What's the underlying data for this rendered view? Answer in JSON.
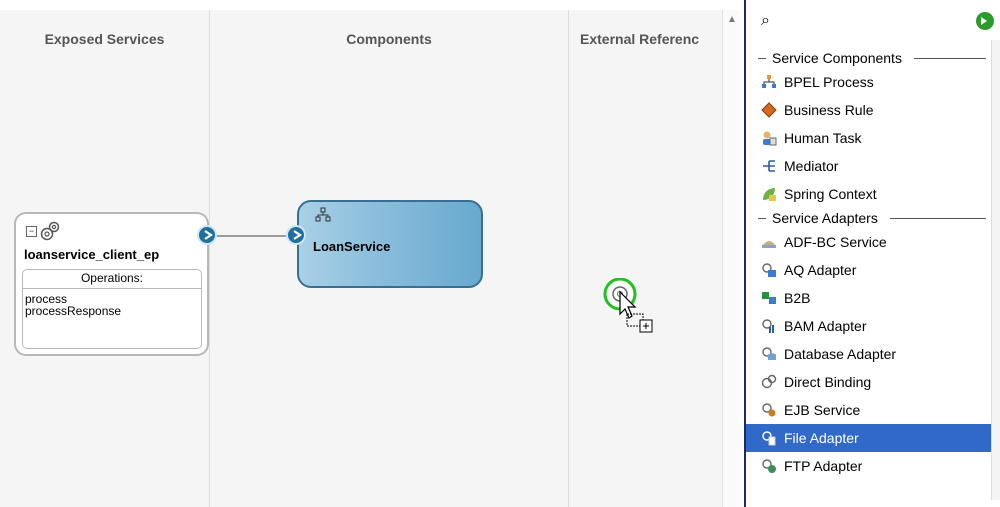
{
  "lanes": {
    "exposed": "Exposed Services",
    "components": "Components",
    "external": "External Referenc"
  },
  "service": {
    "name": "loanservice_client_ep",
    "operations_title": "Operations:",
    "operations": [
      "process",
      "processResponse"
    ]
  },
  "component": {
    "name": "LoanService"
  },
  "palette": {
    "sections": [
      {
        "title": "Service Components",
        "items": [
          {
            "label": "BPEL Process",
            "icon": "bpel-icon"
          },
          {
            "label": "Business Rule",
            "icon": "business-rule-icon"
          },
          {
            "label": "Human Task",
            "icon": "human-task-icon"
          },
          {
            "label": "Mediator",
            "icon": "mediator-icon"
          },
          {
            "label": "Spring Context",
            "icon": "spring-icon"
          }
        ]
      },
      {
        "title": "Service Adapters",
        "items": [
          {
            "label": "ADF-BC Service",
            "icon": "adf-bc-icon"
          },
          {
            "label": "AQ Adapter",
            "icon": "aq-adapter-icon"
          },
          {
            "label": "B2B",
            "icon": "b2b-icon"
          },
          {
            "label": "BAM Adapter",
            "icon": "bam-adapter-icon"
          },
          {
            "label": "Database Adapter",
            "icon": "database-adapter-icon"
          },
          {
            "label": "Direct Binding",
            "icon": "direct-binding-icon"
          },
          {
            "label": "EJB Service",
            "icon": "ejb-service-icon"
          },
          {
            "label": "File Adapter",
            "icon": "file-adapter-icon",
            "selected": true
          },
          {
            "label": "FTP Adapter",
            "icon": "ftp-adapter-icon"
          }
        ]
      }
    ]
  },
  "colors": {
    "selection": "#3069c8",
    "component_border": "#3a6f93",
    "port": "#1f6f9f",
    "drop_ring": "#22c122"
  }
}
